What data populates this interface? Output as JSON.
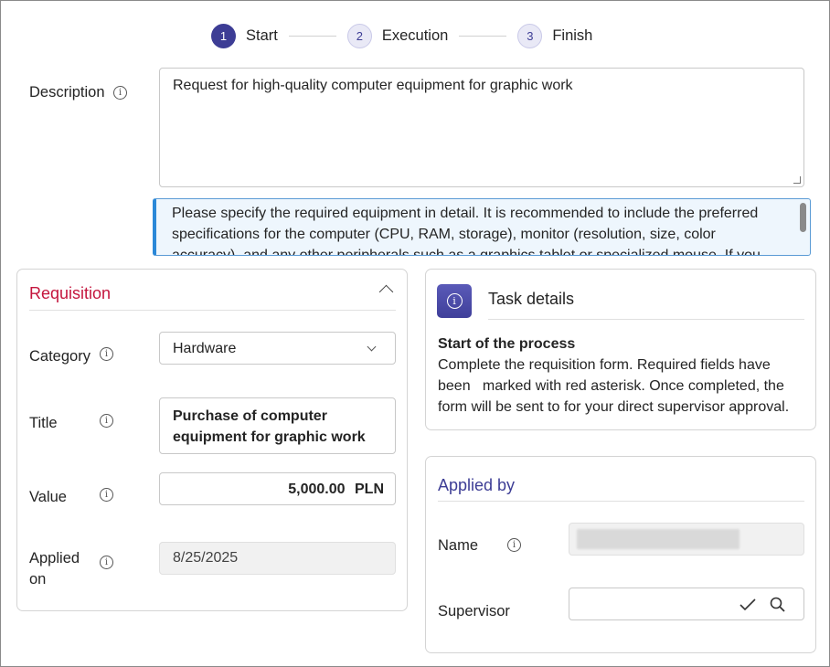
{
  "stepper": {
    "steps": [
      {
        "number": "1",
        "label": "Start"
      },
      {
        "number": "2",
        "label": "Execution"
      },
      {
        "number": "3",
        "label": "Finish"
      }
    ],
    "active_index": 0
  },
  "description": {
    "label": "Description",
    "value": "Request for high-quality computer equipment for graphic work"
  },
  "hint": {
    "text": "Please specify the required equipment in detail. It is recommended to include the preferred specifications for the computer (CPU, RAM, storage), monitor (resolution, size, color accuracy), and any other peripherals such as a graphics tablet or specialized mouse. If you have specific"
  },
  "requisition": {
    "title": "Requisition",
    "category": {
      "label": "Category",
      "value": "Hardware"
    },
    "title_field": {
      "label": "Title",
      "value": "Purchase of computer equipment for graphic work"
    },
    "value_field": {
      "label": "Value",
      "amount": "5,000.00",
      "currency": "PLN"
    },
    "applied_on": {
      "label": "Applied on",
      "value": "8/25/2025"
    }
  },
  "task_details": {
    "title": "Task details",
    "heading": "Start of the process",
    "body": "Complete the requisition form. Required fields have been   marked with red asterisk. Once completed, the form will be sent to for your direct supervisor approval."
  },
  "applied_by": {
    "title": "Applied by",
    "name": {
      "label": "Name",
      "value": ""
    },
    "supervisor": {
      "label": "Supervisor",
      "value": ""
    }
  },
  "icons": {
    "info": "info-icon",
    "check": "check-icon",
    "search": "search-icon",
    "chevron_up": "chevron-up-icon",
    "chevron_down": "chevron-down-icon"
  },
  "colors": {
    "accent": "#3d3d95",
    "required_title": "#c4153d",
    "hint_border": "#2b88d8",
    "hint_bg": "#eef6fd"
  }
}
